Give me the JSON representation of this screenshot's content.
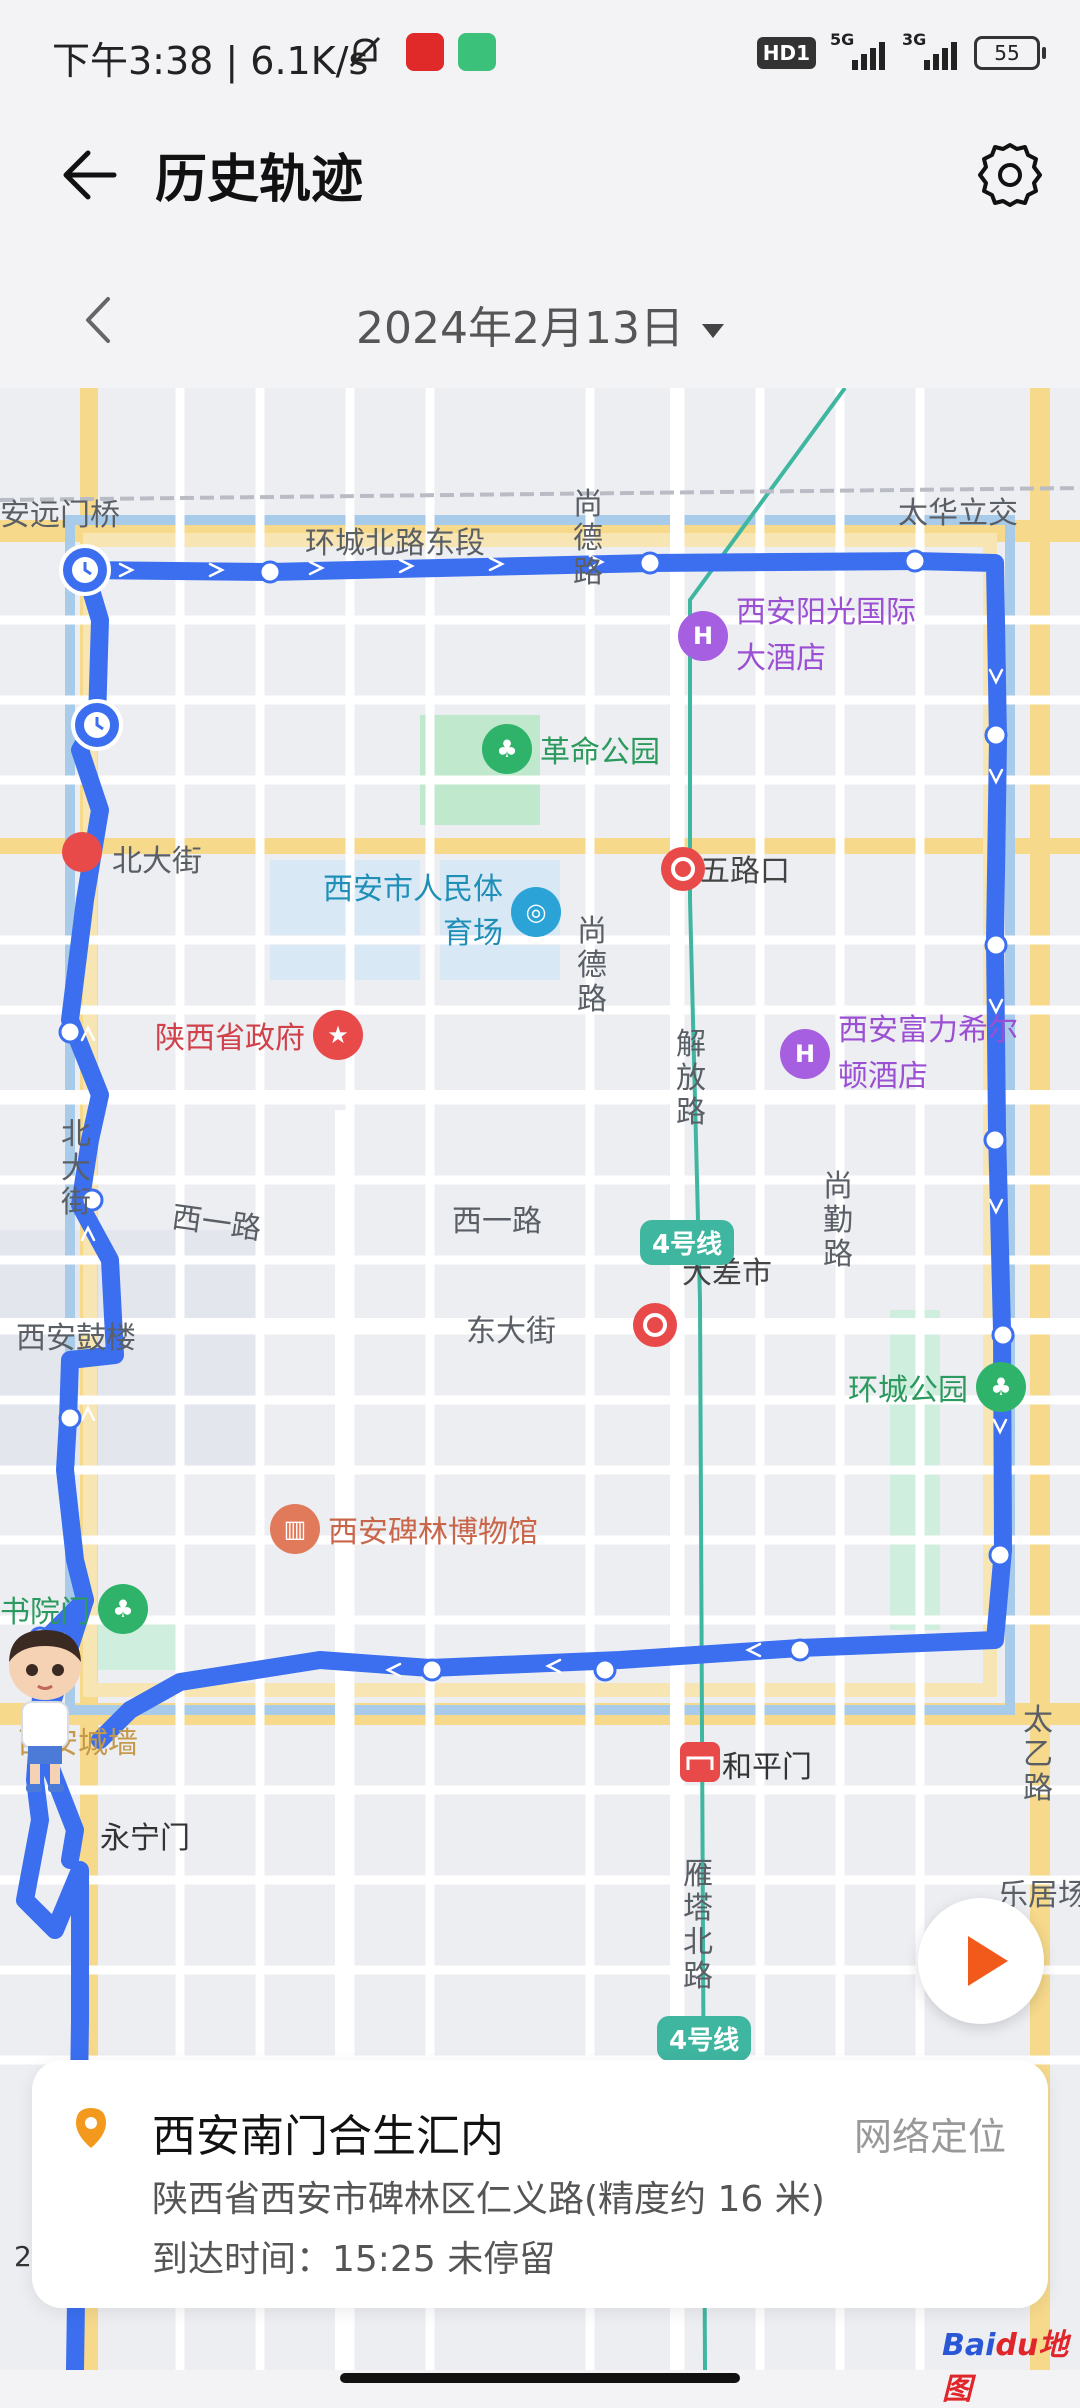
{
  "status_bar": {
    "time": "下午3:38 | 6.1K/s",
    "hd": "HD1",
    "sig1": "5G",
    "sig2": "3G",
    "battery": "55"
  },
  "header": {
    "title": "历史轨迹",
    "back_icon": "arrow-left-icon",
    "settings_icon": "gear-icon"
  },
  "date_nav": {
    "date": "2024年2月13日",
    "prev_icon": "chevron-left-icon",
    "caret_icon": "caret-down-icon"
  },
  "map": {
    "road_labels": {
      "anyuanmen": "安远门桥",
      "huancheng_n": "环城北路东段",
      "shangde_top": "尚德路",
      "taihua": "太华立交",
      "beidajie": "北大街",
      "shangde_mid": "尚德路",
      "jiefang": "解放路",
      "xiyi_a": "西一路",
      "xiyi_b": "西一路",
      "shangqin": "尚勤路",
      "beidajie_v": "北大街",
      "xian_gulou": "西安鼓楼",
      "dongdajie": "东大街",
      "taiyi": "太乙路",
      "yanta": "雁塔北路",
      "leju": "乐居场",
      "xian_chengqiang": "西安城墙",
      "yongningmen": "永宁门"
    },
    "pois": {
      "hotel_sunshine": "西安阳光国际大酒店",
      "geming_park": "革命公园",
      "wulukou": "五路口",
      "stadium": "西安市人民体育场",
      "gov": "陕西省政府",
      "hilton": "西安富力希尔顿酒店",
      "dachashi": "大差市",
      "huancheng_park": "环城公园",
      "beilin_museum": "西安碑林博物馆",
      "shuyuanmen": "书院门",
      "hepingmen": "和平门"
    },
    "metro_tags": [
      "4号线",
      "4号线"
    ],
    "scale": "2"
  },
  "info_card": {
    "place": "西安南门合生汇内",
    "source": "网络定位",
    "address": "陕西省西安市碑林区仁义路(精度约 16 米)",
    "arrival": "到达时间：15:25  未停留"
  },
  "colors": {
    "track": "#3b6ff0",
    "accent_orange": "#f25a1c",
    "metro": "#3fb6a0"
  },
  "branding": {
    "logo_a": "Bai",
    "logo_b": "du地图"
  }
}
